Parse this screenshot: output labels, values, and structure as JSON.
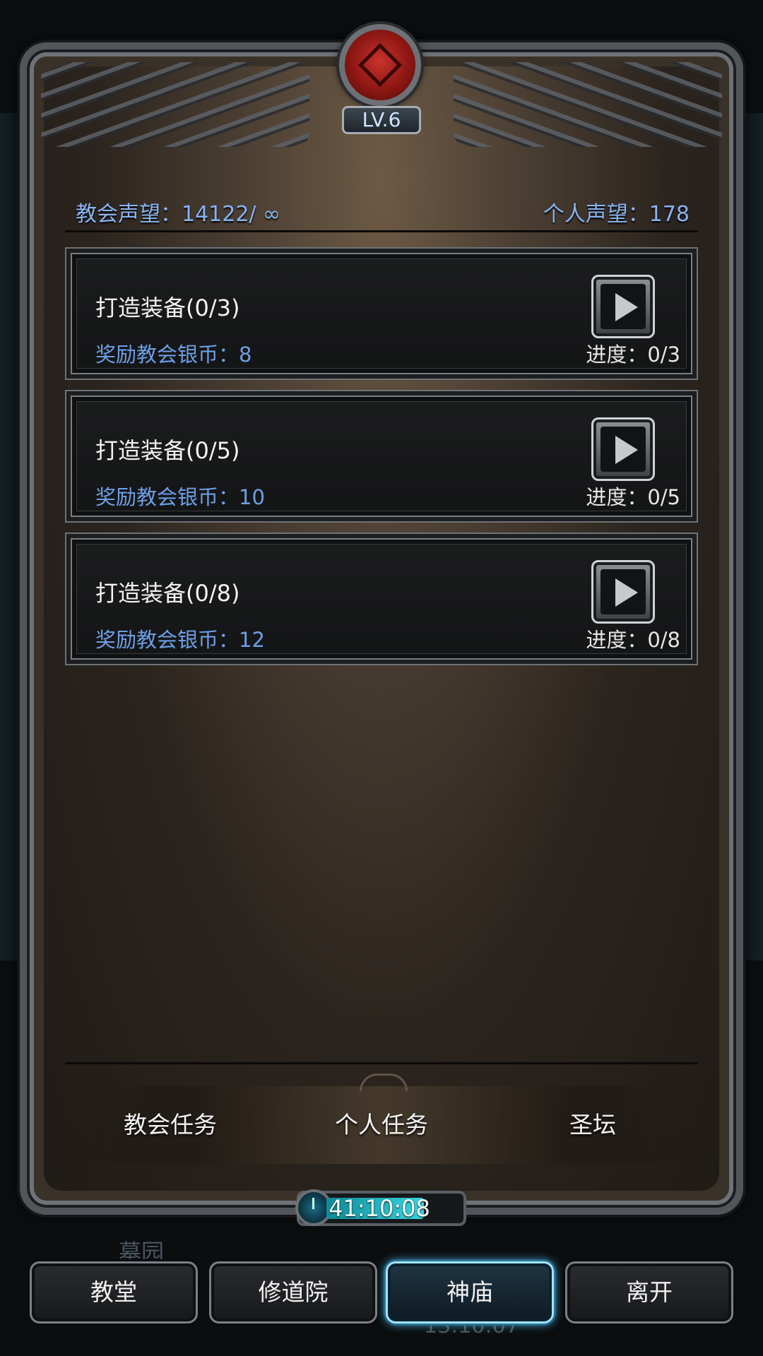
{
  "header": {
    "level_label": "LV.6",
    "church_reputation": "教会声望：14122/ ∞",
    "personal_reputation": "个人声望：178"
  },
  "tasks": [
    {
      "title": "打造装备(0/3)",
      "reward": "奖励教会银币：8",
      "progress": "进度：0/3"
    },
    {
      "title": "打造装备(0/5)",
      "reward": "奖励教会银币：10",
      "progress": "进度：0/5"
    },
    {
      "title": "打造装备(0/8)",
      "reward": "奖励教会银币：12",
      "progress": "进度：0/8"
    }
  ],
  "tabs": [
    {
      "label": "教会任务"
    },
    {
      "label": "个人任务",
      "selected": true
    },
    {
      "label": "圣坛"
    }
  ],
  "timer": {
    "value": "41:10:08",
    "fill_fraction": 0.72
  },
  "background": {
    "location_text": "墓园",
    "clock_text": "13:10:07"
  },
  "nav": [
    {
      "label": "教堂"
    },
    {
      "label": "修道院"
    },
    {
      "label": "神庙",
      "active": true
    },
    {
      "label": "离开"
    }
  ],
  "colors": {
    "accent_blue": "#88b4f1",
    "reward_blue": "#6c9fe6",
    "active_glow": "#4cc6ff",
    "emblem_red": "#c9332c"
  },
  "icons": {
    "task_action": "play-icon",
    "timer": "clock-icon",
    "emblem": "church-emblem-icon"
  }
}
